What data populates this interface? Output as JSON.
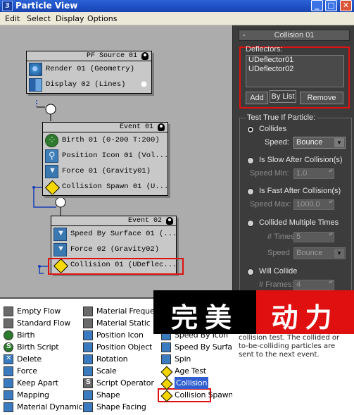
{
  "window": {
    "title": "Particle View",
    "app_icon": "3ds-max-icon"
  },
  "menu": [
    "Edit",
    "Select",
    "Display",
    "Options"
  ],
  "graph": {
    "source": {
      "header": "PF Source 01",
      "operators": [
        {
          "label": "Render 01 (Geometry)",
          "icon": "render-icon"
        },
        {
          "label": "Display 02 (Lines)",
          "icon": "display-icon"
        }
      ]
    },
    "event1": {
      "header": "Event 01",
      "operators": [
        {
          "label": "Birth 01 (0-200 T:200)",
          "icon": "birth-icon"
        },
        {
          "label": "Position Icon 01 (Vol...",
          "icon": "position-icon"
        },
        {
          "label": "Force 01 (Gravity01)",
          "icon": "force-icon"
        },
        {
          "label": "Collision Spawn 01 (U...",
          "icon": "collision-spawn-icon"
        }
      ]
    },
    "event2": {
      "header": "Event 02",
      "operators": [
        {
          "label": "Speed By Surface 01 (...",
          "icon": "speed-surface-icon"
        },
        {
          "label": "Force 02 (Gravity02)",
          "icon": "force-icon"
        },
        {
          "label": "Collision 01 (UDeflec...",
          "icon": "collision-icon"
        }
      ]
    }
  },
  "panel": {
    "rollout_title": "Collision 01",
    "rollout_toggle": "-",
    "deflectors_label": "Deflectors:",
    "deflectors": [
      "UDeflector01",
      "UDeflector02"
    ],
    "buttons": {
      "add": "Add",
      "by_list": "By List",
      "remove": "Remove"
    },
    "test_label": "Test True If Particle:",
    "options": {
      "collides": "Collides",
      "speed_label": "Speed:",
      "speed_value": "Bounce",
      "slow": "Is Slow After Collision(s)",
      "speed_min_label": "Speed Min:",
      "speed_min_value": "1.0",
      "fast": "Is Fast After Collision(s)",
      "speed_max_label": "Speed Max:",
      "speed_max_value": "1000.0",
      "multiple": "Collided Multiple Times",
      "times_label": "# Times:",
      "times_value": "5",
      "speed2_label": "Speed",
      "speed2_value": "Bounce",
      "will": "Will Collide",
      "frames_label": "# Frames:",
      "frames_value": "4"
    }
  },
  "depot": {
    "col1": [
      {
        "label": "Empty Flow",
        "icon": "gray"
      },
      {
        "label": "Standard Flow",
        "icon": "gray"
      },
      {
        "label": "Birth",
        "icon": "green"
      },
      {
        "label": "Birth Script",
        "icon": "green-s"
      },
      {
        "label": "Delete",
        "icon": "x"
      },
      {
        "label": "Force",
        "icon": "blue"
      },
      {
        "label": "Keep Apart",
        "icon": "blue"
      },
      {
        "label": "Mapping",
        "icon": "blue"
      },
      {
        "label": "Material Dynamic",
        "icon": "blue"
      }
    ],
    "col2": [
      {
        "label": "Material Frequenc",
        "icon": "gray"
      },
      {
        "label": "Material Static",
        "icon": "gray"
      },
      {
        "label": "Position Icon",
        "icon": "blue"
      },
      {
        "label": "Position Object",
        "icon": "blue"
      },
      {
        "label": "Rotation",
        "icon": "blue"
      },
      {
        "label": "Scale",
        "icon": "blue"
      },
      {
        "label": "Script Operator",
        "icon": "s"
      },
      {
        "label": "Shape",
        "icon": "blue"
      },
      {
        "label": "Shape Facing",
        "icon": "blue"
      }
    ],
    "col3": [
      {
        "label": "Speed",
        "icon": "blue"
      },
      {
        "label": "Speed By Icon",
        "icon": "blue"
      },
      {
        "label": "Speed By Surfac",
        "icon": "blue"
      },
      {
        "label": "Spin",
        "icon": "blue"
      },
      {
        "label": "Age Test",
        "icon": "yellow"
      },
      {
        "label": "Collision",
        "icon": "yellow"
      },
      {
        "label": "Collision Spawn",
        "icon": "yellow"
      }
    ],
    "description": "collision test. The collided or to-be-colliding particles are sent to the next event."
  },
  "watermark": {
    "left": "完美",
    "right": "动力"
  }
}
